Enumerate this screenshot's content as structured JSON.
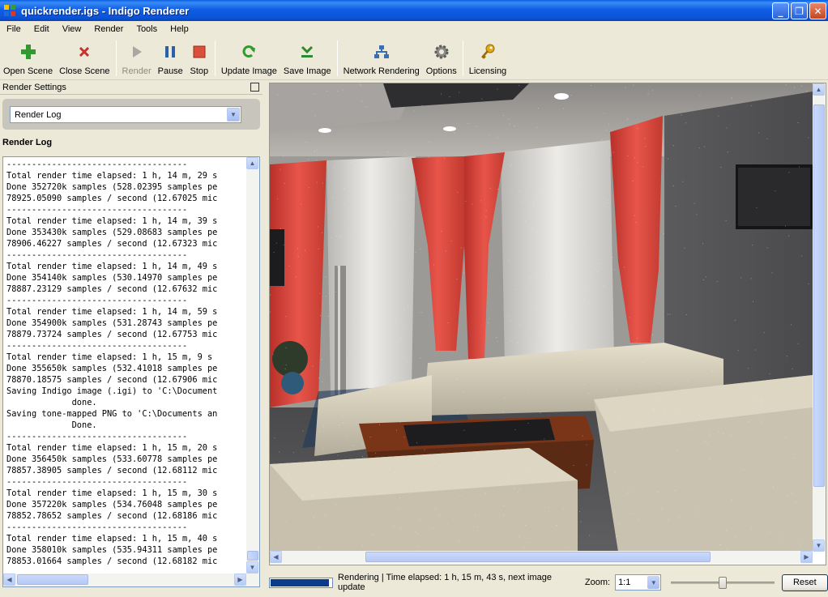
{
  "window": {
    "title": "quickrender.igs - Indigo Renderer",
    "icon": "indigo-logo-icon",
    "controls": [
      "minimize-icon",
      "restore-icon",
      "close-icon"
    ]
  },
  "menu": [
    "File",
    "Edit",
    "View",
    "Render",
    "Tools",
    "Help"
  ],
  "toolbar": {
    "open_scene": "Open Scene",
    "close_scene": "Close Scene",
    "render": "Render",
    "pause": "Pause",
    "stop": "Stop",
    "update_image": "Update Image",
    "save_image": "Save Image",
    "network_rendering": "Network Rendering",
    "options": "Options",
    "licensing": "Licensing"
  },
  "left_panel": {
    "title": "Render Settings",
    "selector_value": "Render Log",
    "log_title": "Render Log",
    "log_lines": [
      "------------------------------------",
      "Total render time elapsed: 1 h, 14 m, 29 s",
      "Done 352720k samples (528.02395 samples pe",
      "78925.05090 samples / second (12.67025 mic",
      "------------------------------------",
      "Total render time elapsed: 1 h, 14 m, 39 s",
      "Done 353430k samples (529.08683 samples pe",
      "78906.46227 samples / second (12.67323 mic",
      "------------------------------------",
      "Total render time elapsed: 1 h, 14 m, 49 s",
      "Done 354140k samples (530.14970 samples pe",
      "78887.23129 samples / second (12.67632 mic",
      "------------------------------------",
      "Total render time elapsed: 1 h, 14 m, 59 s",
      "Done 354900k samples (531.28743 samples pe",
      "78879.73724 samples / second (12.67753 mic",
      "------------------------------------",
      "Total render time elapsed: 1 h, 15 m, 9 s",
      "Done 355650k samples (532.41018 samples pe",
      "78870.18575 samples / second (12.67906 mic",
      "Saving Indigo image (.igi) to 'C:\\Document",
      "             done.",
      "Saving tone-mapped PNG to 'C:\\Documents an",
      "             Done.",
      "------------------------------------",
      "Total render time elapsed: 1 h, 15 m, 20 s",
      "Done 356450k samples (533.60778 samples pe",
      "78857.38905 samples / second (12.68112 mic",
      "------------------------------------",
      "Total render time elapsed: 1 h, 15 m, 30 s",
      "Done 357220k samples (534.76048 samples pe",
      "78852.78652 samples / second (12.68186 mic",
      "------------------------------------",
      "Total render time elapsed: 1 h, 15 m, 40 s",
      "Done 358010k samples (535.94311 samples pe",
      "78853.01664 samples / second (12.68182 mic"
    ]
  },
  "status": {
    "progress": 0.95,
    "text": "Rendering | Time elapsed: 1 h, 15 m, 43 s, next image update",
    "zoom_label": "Zoom:",
    "zoom_value": "1:1",
    "zoom_slider_level": 0.5,
    "reset_label": "Reset"
  },
  "colors": {
    "titlebar": "#0b53d6",
    "curtain_red": "#e0453a",
    "progress_fill": "#0a3c8c"
  }
}
